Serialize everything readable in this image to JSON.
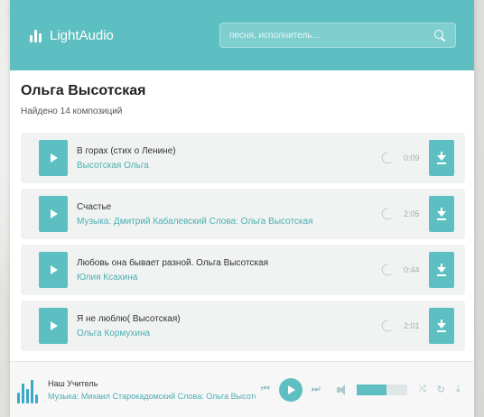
{
  "header": {
    "app_name": "LightAudio",
    "search_placeholder": "песня, исполнитель..."
  },
  "page": {
    "artist_title": "Ольга Высотская",
    "found_text": "Найдено 14 композиций"
  },
  "tracks": [
    {
      "title": "В горах (стих о Ленине)",
      "artist": "Высотская Ольга",
      "duration": "0:09"
    },
    {
      "title": "Счастье",
      "artist": "Музыка: Дмитрий Кабалевский Слова: Ольга Высотская",
      "duration": "2:05"
    },
    {
      "title": "Любовь она бывает разной. Ольга Высотская",
      "artist": "Юлия Ксахина",
      "duration": "0:44"
    },
    {
      "title": "Я не люблю( Высотская)",
      "artist": "Ольга Кормухина",
      "duration": "2:01"
    }
  ],
  "player": {
    "now_title": "Наш Учитель",
    "now_artist": "Музыка: Михаил Старокадомский Слова: Ольга Высотская",
    "volume_fraction": 0.6
  },
  "colors": {
    "accent": "#5dbfc1",
    "link": "#4aaeb1"
  },
  "icons": {
    "logo": "lightaudio-logo-icon",
    "search": "search-icon",
    "play": "play-icon",
    "phone": "phone-icon",
    "download": "download-icon",
    "prev": "previous-icon",
    "next": "next-icon",
    "volume": "volume-icon",
    "shuffle": "shuffle-icon",
    "repeat": "repeat-icon"
  }
}
